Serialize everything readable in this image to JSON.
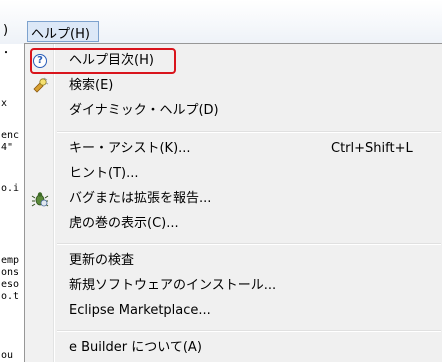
{
  "menubar": {
    "partial_paren": ")",
    "help_menu": "ヘルプ(H)"
  },
  "editor_fragments": [
    "・",
    "x",
    "enc",
    "4\"",
    "o.i",
    "emp",
    "ons",
    "eso",
    "o.t",
    "ou"
  ],
  "help_menu": {
    "items": [
      {
        "label": "ヘルプ目次(H)",
        "icon": "help-circle-icon",
        "highlighted": true
      },
      {
        "label": "検索(E)",
        "icon": "search-flashlight-icon"
      },
      {
        "label": "ダイナミック・ヘルプ(D)",
        "icon": ""
      },
      {
        "label": "キー・アシスト(K)...",
        "accelerator": "Ctrl+Shift+L",
        "icon": ""
      },
      {
        "label": "ヒント(T)...",
        "icon": ""
      },
      {
        "label": "バグまたは拡張を報告...",
        "icon": "bug-report-icon"
      },
      {
        "label": "虎の巻の表示(C)...",
        "icon": ""
      },
      {
        "label": "更新の検査",
        "icon": ""
      },
      {
        "label": "新規ソフトウェアのインストール...",
        "icon": ""
      },
      {
        "label": "Eclipse Marketplace...",
        "icon": ""
      },
      {
        "label": "e Builder について(A)",
        "icon": ""
      }
    ]
  },
  "colors": {
    "highlight_border": "#d9141c",
    "menu_background": "#f0f0f0",
    "help_icon_blue": "#2a5db8"
  }
}
